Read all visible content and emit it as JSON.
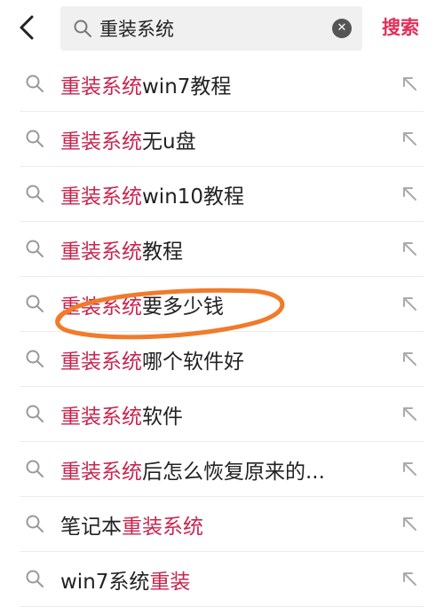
{
  "header": {
    "query": "重装系统",
    "search_label": "搜索"
  },
  "suggestions": [
    {
      "hl": "重装系统",
      "rest": "win7教程"
    },
    {
      "hl": "重装系统",
      "rest": "无u盘"
    },
    {
      "hl": "重装系统",
      "rest": "win10教程"
    },
    {
      "hl": "重装系统",
      "rest": "教程"
    },
    {
      "hl": "重装系统",
      "rest": "要多少钱"
    },
    {
      "hl": "重装系统",
      "rest": "哪个软件好"
    },
    {
      "hl": "重装系统",
      "rest": "软件"
    },
    {
      "hl": "重装系统",
      "rest": "后怎么恢复原来的..."
    },
    {
      "pre": "笔记本",
      "hl": "重装系统"
    },
    {
      "pre": "win7系统",
      "hl": "重装"
    }
  ],
  "icons": {
    "back": "chevron-left-icon",
    "search": "search-icon",
    "clear": "clear-icon",
    "fill": "arrow-up-left-icon"
  },
  "colors": {
    "highlight": "#c8254f",
    "search_button": "#e0305a",
    "annotation": "#f07b2a"
  }
}
